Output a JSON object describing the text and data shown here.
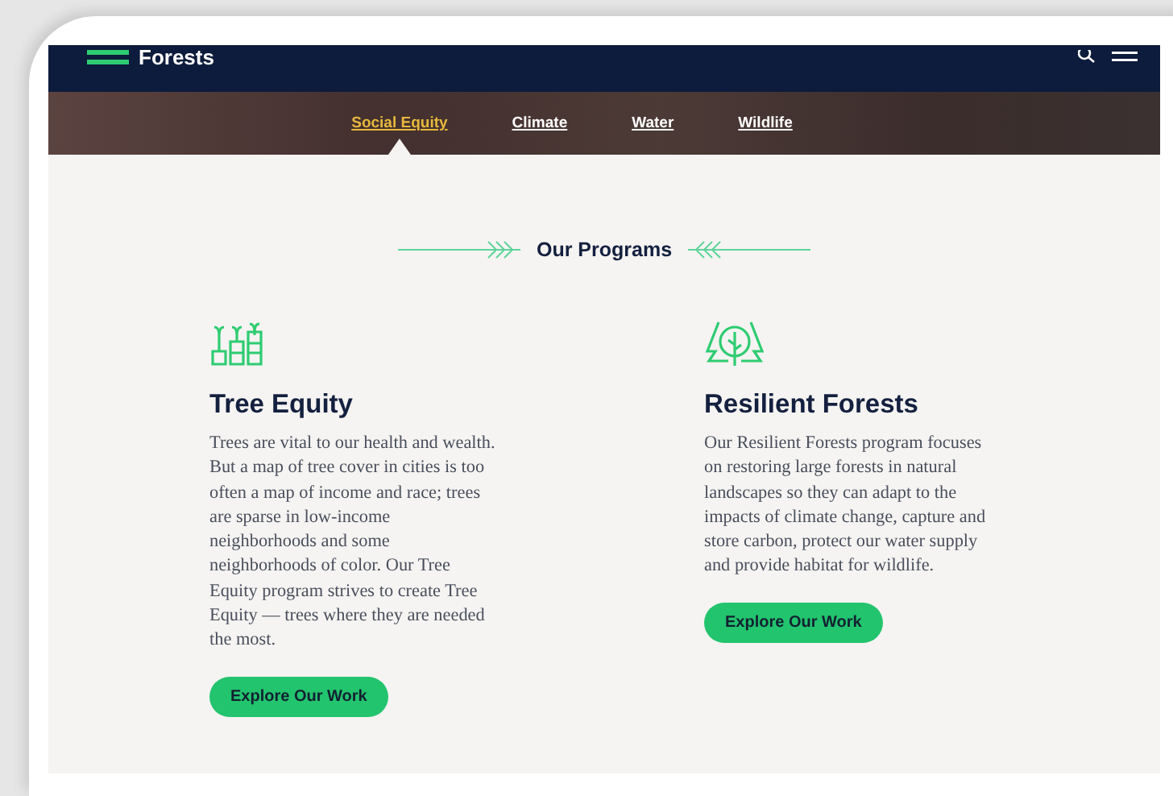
{
  "header": {
    "logo": "Forests"
  },
  "nav": {
    "tabs": [
      {
        "label": "Social Equity",
        "selected": true
      },
      {
        "label": "Climate",
        "selected": false
      },
      {
        "label": "Water",
        "selected": false
      },
      {
        "label": "Wildlife",
        "selected": false
      }
    ]
  },
  "section": {
    "title": "Our Programs"
  },
  "programs": [
    {
      "kind": "seedlings",
      "title": "Tree Equity",
      "text": "Trees are vital to our health and wealth. But a map of tree cover in cities is too often a map of income and race; trees are sparse in low-income neighborhoods and some neighborhoods of color. Our Tree Equity program strives to create Tree Equity — trees where they are needed the most.",
      "button": "Explore Our Work"
    },
    {
      "kind": "trees",
      "title": "Resilient Forests",
      "text": "Our Resilient Forests program focuses on restoring large forests in natural landscapes so they can adapt to the impacts of climate change, capture and store carbon, protect our water supply and provide habitat for wildlife.",
      "button": "Explore Our Work"
    }
  ]
}
